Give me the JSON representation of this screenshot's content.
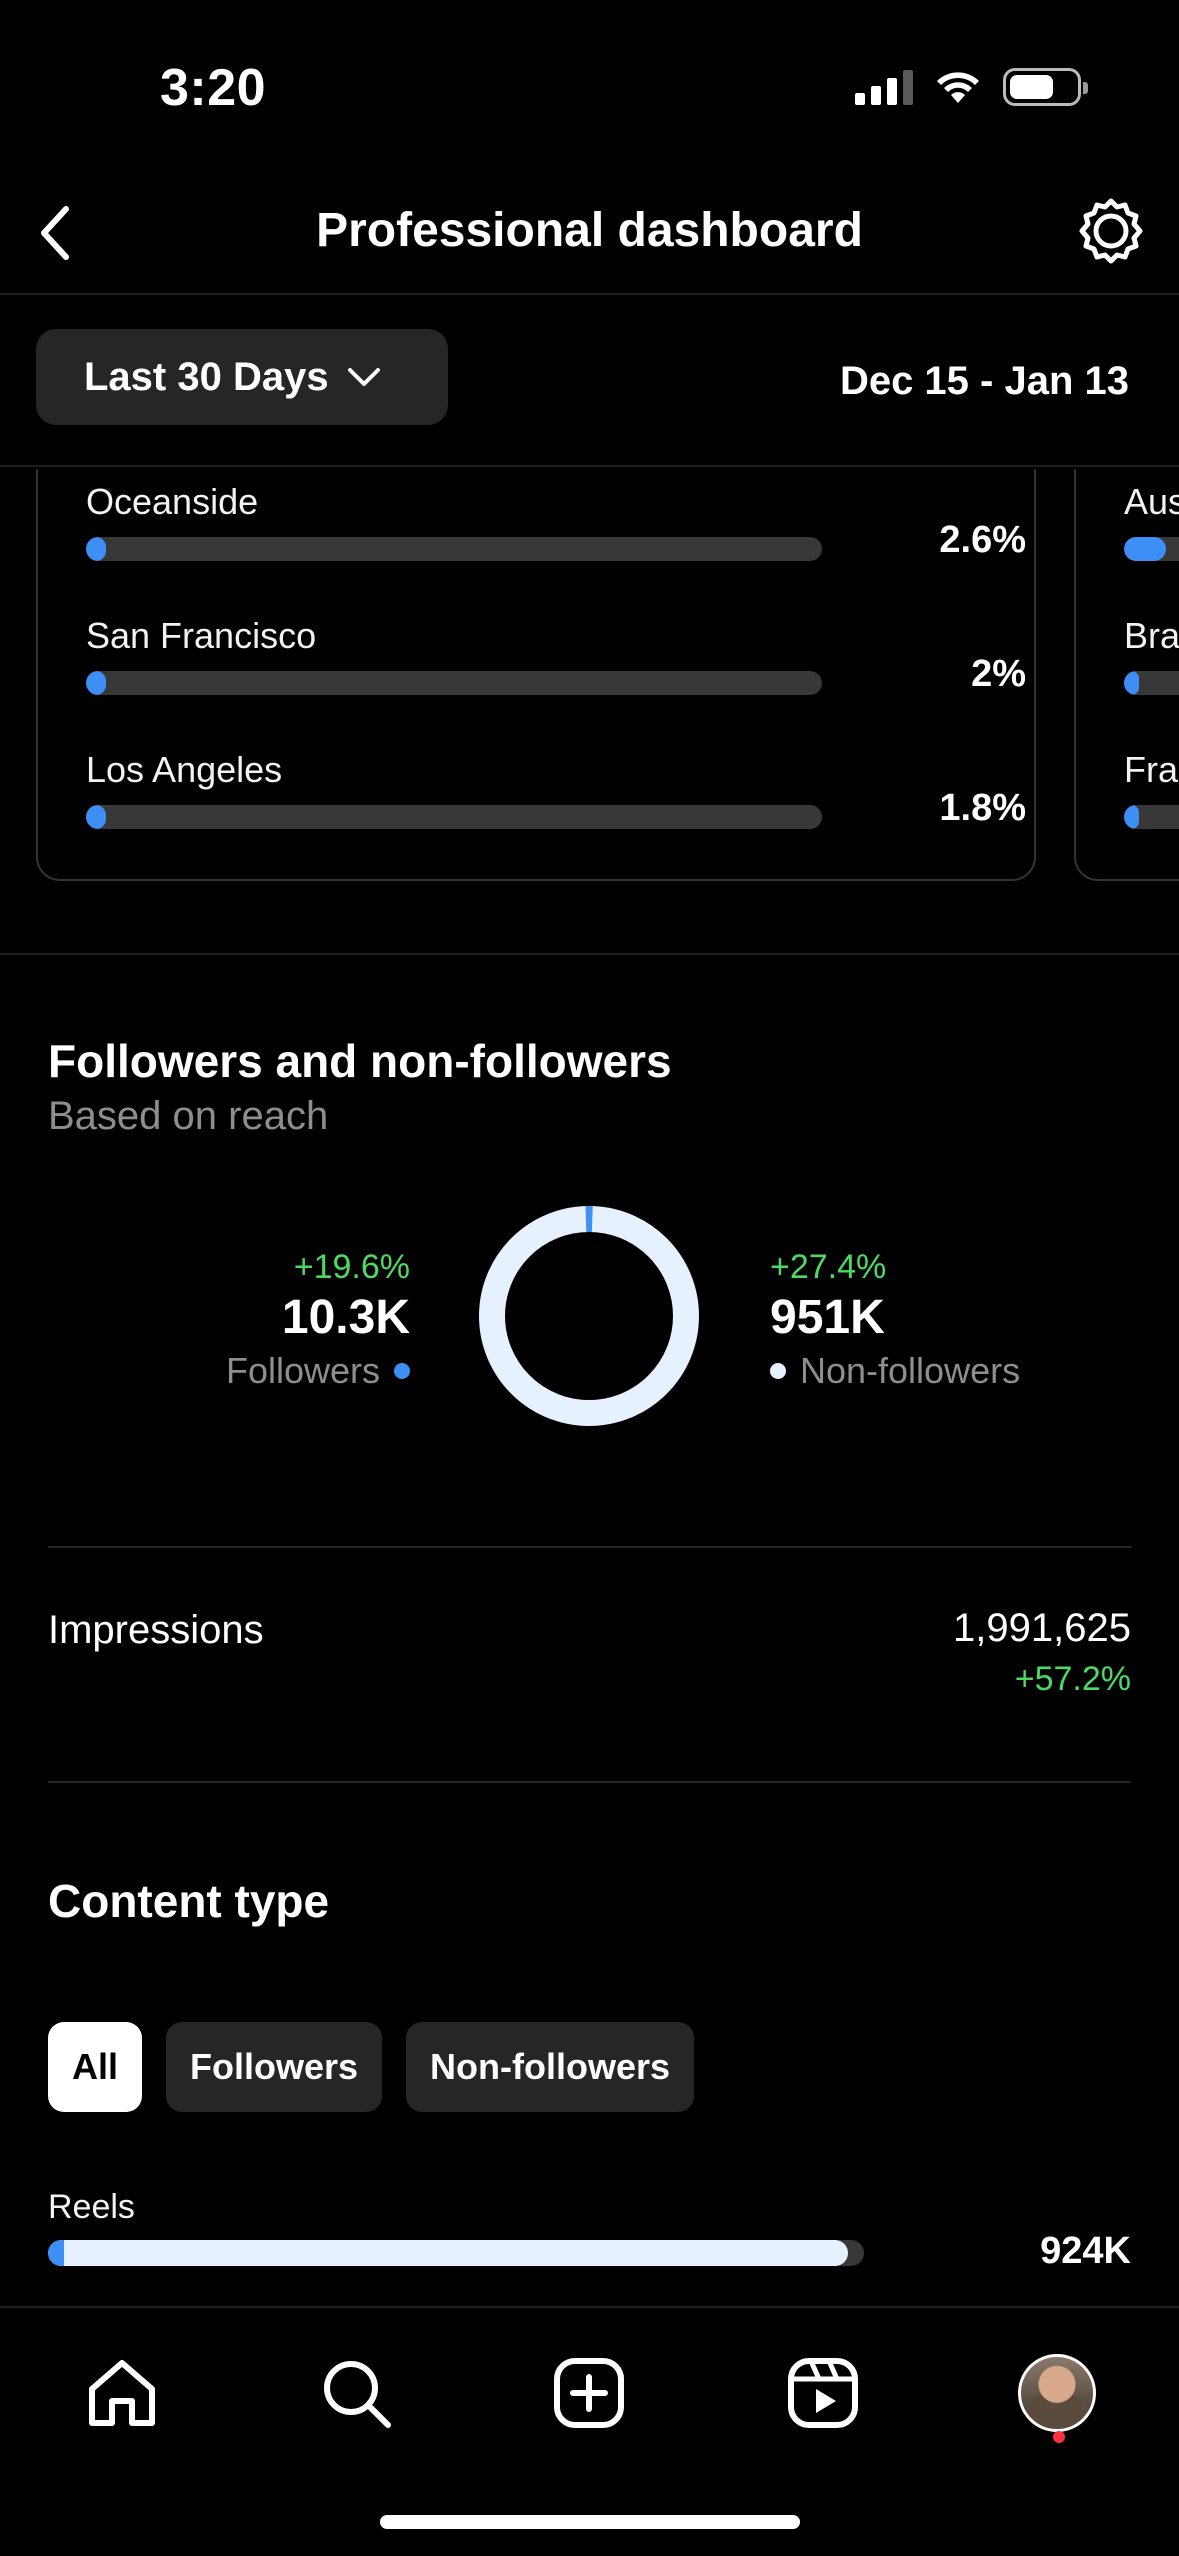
{
  "status_bar": {
    "time": "3:20",
    "battery_level": 0.7
  },
  "header": {
    "title": "Professional dashboard",
    "back_icon": "chevron-left-icon",
    "settings_icon": "gear-icon"
  },
  "filters": {
    "range_label": "Last 30 Days",
    "date_range": "Dec 15 - Jan 13"
  },
  "cities": [
    {
      "name": "Oceanside",
      "value": "2.6%",
      "percent": 2.6
    },
    {
      "name": "San Francisco",
      "value": "2%",
      "percent": 2.0
    },
    {
      "name": "Los Angeles",
      "value": "1.8%",
      "percent": 1.8
    }
  ],
  "countries": [
    {
      "name": "Aus",
      "fill": 0.14
    },
    {
      "name": "Bra",
      "fill": 0.05
    },
    {
      "name": "Fra",
      "fill": 0.05
    }
  ],
  "followers_section": {
    "title": "Followers and non-followers",
    "subtitle": "Based on reach",
    "followers": {
      "change": "+19.6%",
      "value": "10.3K",
      "label": "Followers",
      "color": "#3d8ff5"
    },
    "non_followers": {
      "change": "+27.4%",
      "value": "951K",
      "label": "Non-followers",
      "color": "#e6f0ff"
    },
    "followers_share": 0.011
  },
  "impressions": {
    "label": "Impressions",
    "value": "1,991,625",
    "change": "+57.2%"
  },
  "content_type": {
    "title": "Content type",
    "chips": [
      {
        "label": "All",
        "active": true
      },
      {
        "label": "Followers",
        "active": false
      },
      {
        "label": "Non-followers",
        "active": false
      }
    ],
    "reels": {
      "label": "Reels",
      "value": "924K",
      "fill": 0.98,
      "follower_share": 0.02
    }
  },
  "tab_bar": {
    "tabs": [
      "home-icon",
      "search-icon",
      "create-icon",
      "reels-icon",
      "profile-avatar"
    ]
  },
  "colors": {
    "accent_blue": "#3d8ff5",
    "positive_green": "#4cd964",
    "track": "#383838"
  }
}
